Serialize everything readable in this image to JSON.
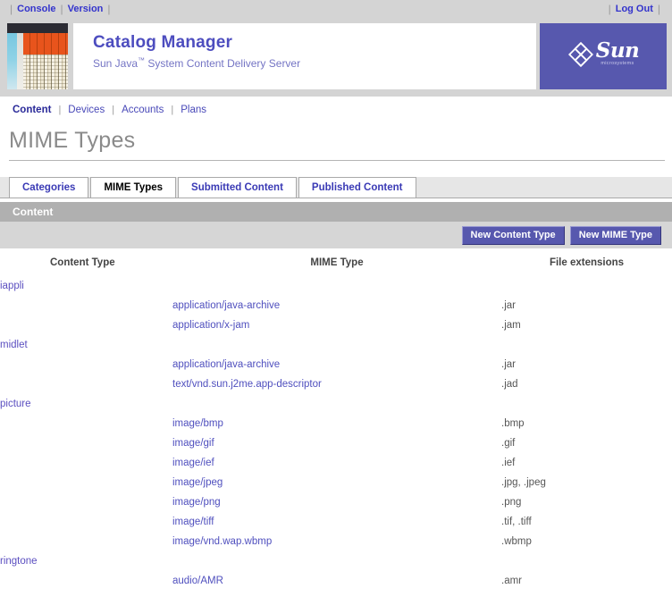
{
  "topbar": {
    "left_links": [
      "Console",
      "Version"
    ],
    "right_links": [
      "Log Out"
    ],
    "separator": "|"
  },
  "masthead": {
    "app_title": "Catalog Manager",
    "app_subtitle_before": "Sun Java",
    "app_subtitle_tm": "™",
    "app_subtitle_after": " System Content Delivery Server",
    "logo_name": "Sun",
    "logo_tagline": "microsystems",
    "logo_bg": "#5758ae"
  },
  "primary_nav": {
    "items": [
      {
        "label": "Content",
        "active": true
      },
      {
        "label": "Devices",
        "active": false
      },
      {
        "label": "Accounts",
        "active": false
      },
      {
        "label": "Plans",
        "active": false
      }
    ],
    "separator": "|"
  },
  "page": {
    "title": "MIME Types"
  },
  "tabs": [
    {
      "label": "Categories",
      "active": false
    },
    {
      "label": "MIME Types",
      "active": true
    },
    {
      "label": "Submitted Content",
      "active": false
    },
    {
      "label": "Published Content",
      "active": false
    }
  ],
  "panel": {
    "header": "Content",
    "buttons": [
      {
        "label": "New Content Type"
      },
      {
        "label": "New MIME Type"
      }
    ]
  },
  "table": {
    "columns": [
      "Content Type",
      "MIME Type",
      "File extensions"
    ],
    "rows": [
      {
        "type": "category",
        "content_type": "iappli"
      },
      {
        "type": "mime",
        "mime": "application/java-archive",
        "ext": ".jar"
      },
      {
        "type": "mime",
        "mime": "application/x-jam",
        "ext": ".jam"
      },
      {
        "type": "category",
        "content_type": "midlet"
      },
      {
        "type": "mime",
        "mime": "application/java-archive",
        "ext": ".jar"
      },
      {
        "type": "mime",
        "mime": "text/vnd.sun.j2me.app-descriptor",
        "ext": ".jad"
      },
      {
        "type": "category",
        "content_type": "picture"
      },
      {
        "type": "mime",
        "mime": "image/bmp",
        "ext": ".bmp"
      },
      {
        "type": "mime",
        "mime": "image/gif",
        "ext": ".gif"
      },
      {
        "type": "mime",
        "mime": "image/ief",
        "ext": ".ief"
      },
      {
        "type": "mime",
        "mime": "image/jpeg",
        "ext": ".jpg, .jpeg"
      },
      {
        "type": "mime",
        "mime": "image/png",
        "ext": ".png"
      },
      {
        "type": "mime",
        "mime": "image/tiff",
        "ext": ".tif, .tiff"
      },
      {
        "type": "mime",
        "mime": "image/vnd.wap.wbmp",
        "ext": ".wbmp"
      },
      {
        "type": "category",
        "content_type": "ringtone"
      },
      {
        "type": "mime",
        "mime": "audio/AMR",
        "ext": ".amr"
      }
    ]
  },
  "colors": {
    "accent_purple": "#5758ae",
    "link_blue": "#4f4fbe",
    "panel_header_gray": "#b0b0b0",
    "toolbar_gray": "#d6d6d6",
    "chrome_gray": "#d4d4d4"
  }
}
